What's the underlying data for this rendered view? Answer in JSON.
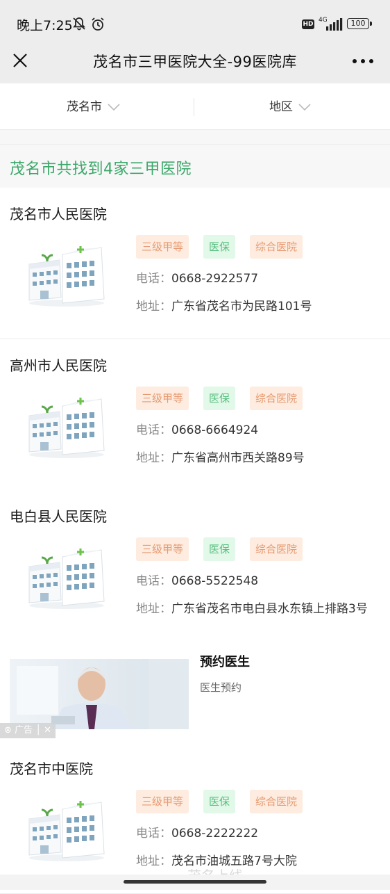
{
  "status": {
    "time": "晚上7:25",
    "hd": "HD",
    "network": "4G",
    "battery": "100"
  },
  "nav": {
    "title": "茂名市三甲医院大全-99医院库"
  },
  "filters": [
    {
      "label": "茂名市"
    },
    {
      "label": "地区"
    }
  ],
  "summary": "茂名市共找到4家三甲医院",
  "labels": {
    "phone": "电话：",
    "address": "地址："
  },
  "hospitals": [
    {
      "name": "茂名市人民医院",
      "tags": [
        "三级甲等",
        "医保",
        "综合医院"
      ],
      "phone": "0668-2922577",
      "address": "广东省茂名市为民路101号"
    },
    {
      "name": "高州市人民医院",
      "tags": [
        "三级甲等",
        "医保",
        "综合医院"
      ],
      "phone": "0668-6664924",
      "address": "广东省高州市西关路89号"
    },
    {
      "name": "电白县人民医院",
      "tags": [
        "三级甲等",
        "医保",
        "综合医院"
      ],
      "phone": "0668-5522548",
      "address": "广东省茂名市电白县水东镇上排路3号"
    },
    {
      "name": "茂名市中医院",
      "tags": [
        "三级甲等",
        "医保",
        "综合医院"
      ],
      "phone": "0668-2222222",
      "address": "茂名市油城五路7号大院"
    }
  ],
  "ad": {
    "title": "预约医生",
    "subtitle": "医生预约",
    "badge": "广告"
  },
  "watermark": "茂名上线",
  "colors": {
    "accent": "#3ca86a",
    "tag_orange_bg": "#fdecdf",
    "tag_orange_text": "#e79a72",
    "tag_green_bg": "#e2f8e8",
    "tag_green_text": "#58bf80"
  }
}
